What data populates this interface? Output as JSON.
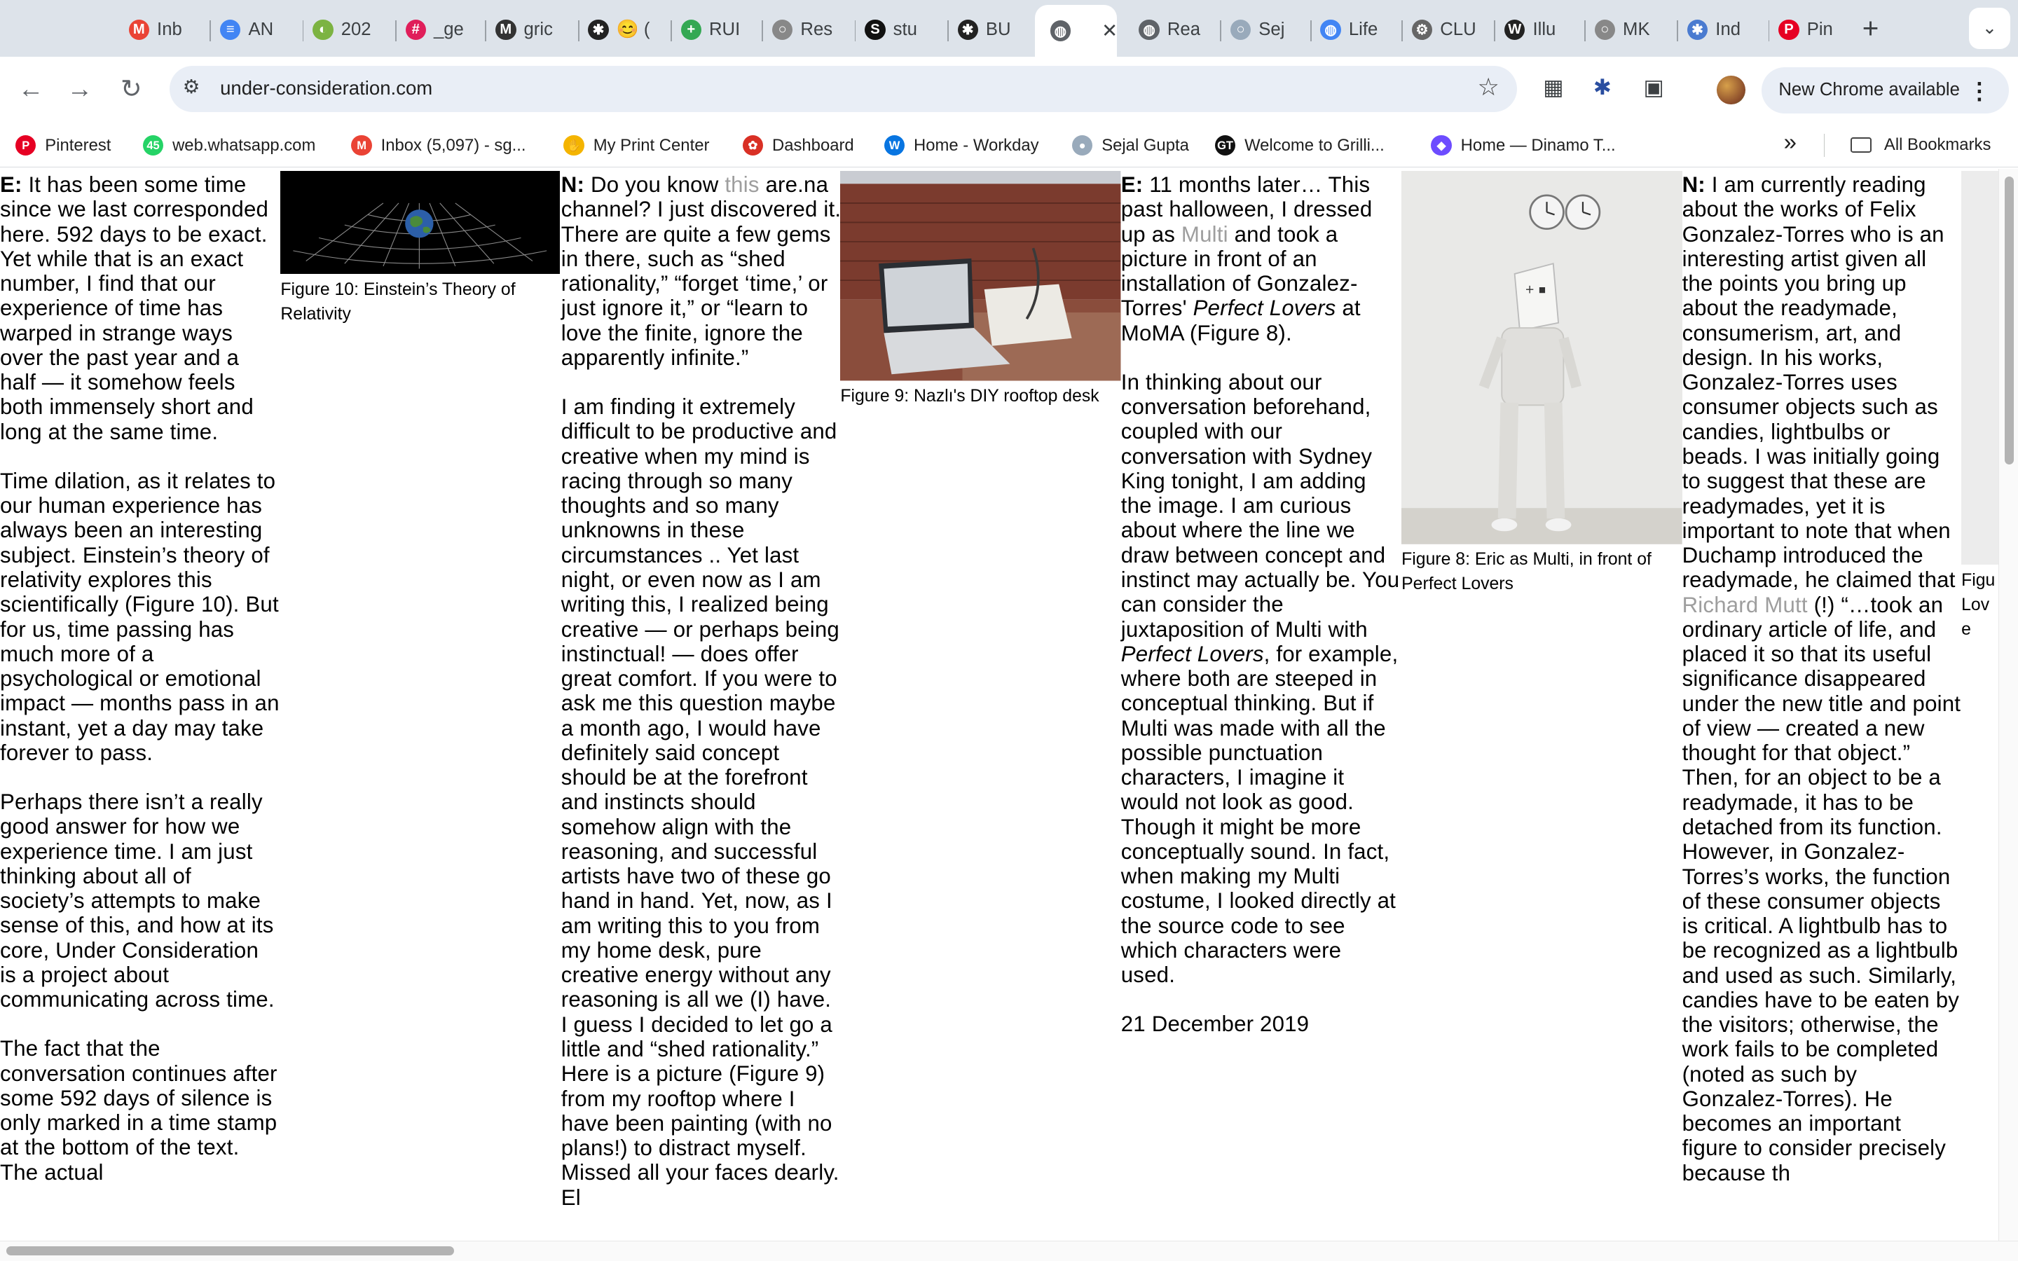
{
  "browser": {
    "tabs": [
      {
        "label": "Inb",
        "icon": "gmail-icon",
        "color": "#ea4335"
      },
      {
        "label": "AN",
        "icon": "docs-icon",
        "color": "#4285f4"
      },
      {
        "label": "202",
        "icon": "app-icon",
        "color": "#7cb342"
      },
      {
        "label": "_ge",
        "icon": "slack-icon",
        "color": "#e01e5a"
      },
      {
        "label": "gric",
        "icon": "m-icon",
        "color": "#333333"
      },
      {
        "label": "😊 (",
        "icon": "asterisk-icon",
        "color": "#222222"
      },
      {
        "label": "RUI",
        "icon": "plus-icon",
        "color": "#34a853"
      },
      {
        "label": "Res",
        "icon": "circle-icon",
        "color": "#888888"
      },
      {
        "label": "stu",
        "icon": "s-icon",
        "color": "#111111"
      },
      {
        "label": "BU",
        "icon": "asterisk-icon",
        "color": "#222222"
      },
      {
        "label": "",
        "icon": "globe-icon",
        "color": "#5f6368",
        "active": true
      },
      {
        "label": "Rea",
        "icon": "globe-icon",
        "color": "#5f6368"
      },
      {
        "label": "Sej",
        "icon": "circle-icon",
        "color": "#9ab"
      },
      {
        "label": "Life",
        "icon": "globe-icon",
        "color": "#4285f4"
      },
      {
        "label": "CLU",
        "icon": "gear-icon",
        "color": "#666666"
      },
      {
        "label": "Illu",
        "icon": "w-icon",
        "color": "#222222"
      },
      {
        "label": "MK",
        "icon": "circle-icon",
        "color": "#888888"
      },
      {
        "label": "Ind",
        "icon": "asterisk-icon",
        "color": "#4a7bd0"
      },
      {
        "label": "Pin",
        "icon": "pinterest-icon",
        "color": "#e60023"
      }
    ],
    "new_tab": "+",
    "tab_menu": "⌄",
    "url": "under-consideration.com",
    "update_label": "New Chrome available",
    "bookmarks": [
      {
        "label": "Pinterest",
        "icon": "pinterest-icon",
        "color": "#e60023"
      },
      {
        "label": "web.whatsapp.com",
        "icon": "whatsapp-icon",
        "color": "#25d366"
      },
      {
        "label": "Inbox (5,097) - sg...",
        "icon": "gmail-icon",
        "color": "#ea4335"
      },
      {
        "label": "My Print Center",
        "icon": "hand-icon",
        "color": "#f4b400"
      },
      {
        "label": "Dashboard",
        "icon": "gear-icon",
        "color": "#d93025"
      },
      {
        "label": "Home - Workday",
        "icon": "workday-icon",
        "color": "#0875e1"
      },
      {
        "label": "Sejal Gupta",
        "icon": "circle-icon",
        "color": "#9ab"
      },
      {
        "label": "Welcome to Grilli...",
        "icon": "gt-icon",
        "color": "#111111"
      },
      {
        "label": "Home — Dinamo T...",
        "icon": "dinamo-icon",
        "color": "#6d4cff"
      }
    ],
    "more_bookmarks": "»",
    "all_bookmarks": "All Bookmarks"
  },
  "article": {
    "col1": {
      "speaker": "E:",
      "p1": " It has been some time since we last corresponded here. 592 days to be exact. Yet while that is an exact number, I find that our experience of time has warped in strange ways over the past year and a half — it somehow feels both immensely short and long at the same time.",
      "p2": "Time dilation, as it relates to our human experience has always been an interesting subject. Einstein’s theory of relativity explores this scientifically (Figure 10). But for us, time passing has much more of a psychological or emotional impact — months pass in an instant, yet a day may take forever to pass.",
      "p3": "Perhaps there isn’t a really good answer for how we experience time. I am just thinking about all of society’s attempts to make sense of this, and how at its core, Under Consideration is a project about communicating across time.",
      "p4": "The fact that the conversation continues after some 592 days of silence is only marked in a time stamp at the bottom of the text. The actual"
    },
    "fig10": {
      "caption": "Figure 10: Einstein’s Theory of Relativity"
    },
    "col3": {
      "speaker": "N:",
      "p1a": " Do you know ",
      "p1link": "this",
      "p1b": " are.na channel? I just discovered it. There are quite a few gems in there, such as “shed rationality,” “forget ‘time,’ or just ignore it,” or “learn to love the finite, ignore the apparently infinite.”",
      "p2": "I am finding it extremely difficult to be productive and creative when my mind is racing through so many thoughts and so many unknowns in these circumstances .. Yet last night, or even now as I am writing this, I realized being creative — or perhaps being instinctual! — does offer great comfort. If you were to ask me this question maybe a month ago, I would have definitely said concept should be at the forefront and instincts should somehow align with the reasoning, and successful artists have two of these go hand in hand. Yet, now, as I am writing this to you from my home desk, pure creative energy without any reasoning is all we (I) have. I guess I decided to let go a little and “shed rationality.” Here is a picture (Figure 9) from my rooftop where I have been painting (with no plans!) to distract myself. Missed all your faces dearly. El"
    },
    "fig9": {
      "caption": "Figure 9: Nazlı's DIY rooftop desk"
    },
    "col5": {
      "speaker": "E:",
      "p1a": " 11 months later… This past halloween, I dressed up as ",
      "p1link": "Multi",
      "p1b": " and took a picture in front of an installation of Gonzalez-Torres' ",
      "p1italic": "Perfect Lovers",
      "p1c": " at MoMA (Figure 8).",
      "p2a": "In thinking about our conversation beforehand, coupled with our conversation with Sydney King tonight, I am adding the image. I am curious about where the line we draw between concept and instinct may actually be. You can consider the juxtaposition of Multi with ",
      "p2italic": "Perfect Lovers",
      "p2b": ", for example, where both are steeped in conceptual thinking. But if Multi was made with all the possible punctuation characters, I imagine it would not look as good. Though it might be more conceptually sound. In fact, when making my Multi costume, I looked directly at the source code to see which characters were used.",
      "date": "21 December 2019"
    },
    "fig8": {
      "caption": "Figure 8: Eric as Multi, in front of Perfect Lovers"
    },
    "col7": {
      "speaker": "N:",
      "p1a": " I am currently reading about the works of Felix Gonzalez-Torres who is an interesting artist given all the points you bring up about the readymade, consumerism, art, and design. In his works, Gonzalez-Torres uses consumer objects such as candies, lightbulbs or beads. I was initially going to suggest that these are readymades, yet it is important to note that when Duchamp introduced the readymade, he claimed that ",
      "p1link": "Richard Mutt",
      "p1b": " (!) “…took an ordinary article of life, and placed it so that its useful significance disappeared under the new title and point of view — created a new thought for that object.” Then, for an object to be a readymade, it has to be detached from its function. However, in Gonzalez-Torres’s works, the function of these consumer objects is critical. A lightbulb has to be recognized as a lightbulb and used as such. Similarly, candies have to be eaten by the visitors; otherwise, the work fails to be completed (noted as such by Gonzalez-Torres). He becomes an important figure to consider precisely because th"
    },
    "fig_partial": {
      "caption": "Figu Love"
    }
  }
}
